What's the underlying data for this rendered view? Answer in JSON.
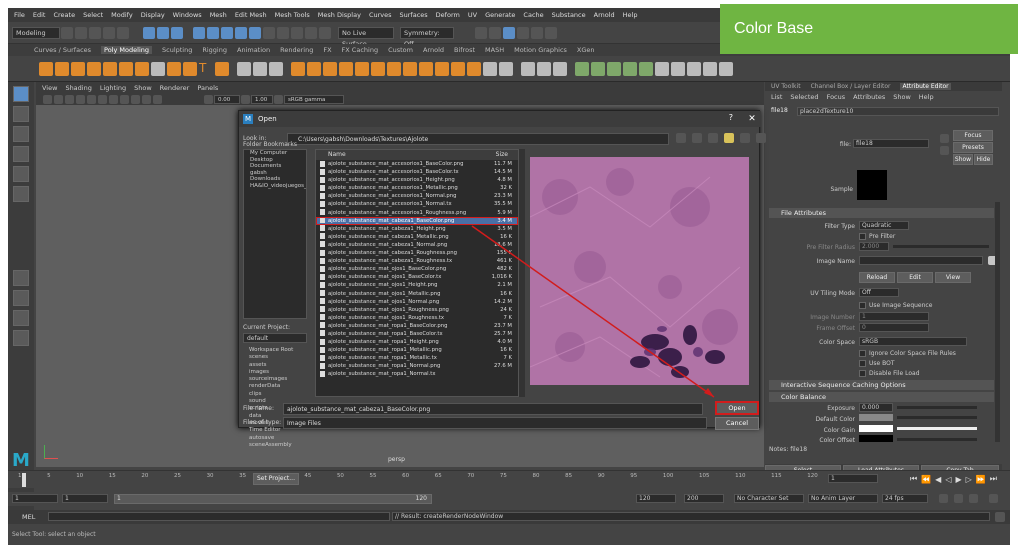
{
  "banner": {
    "label": "Color Base"
  },
  "menubar": [
    "File",
    "Edit",
    "Create",
    "Select",
    "Modify",
    "Display",
    "Windows",
    "Mesh",
    "Edit Mesh",
    "Mesh Tools",
    "Mesh Display",
    "Curves",
    "Surfaces",
    "Deform",
    "UV",
    "Generate",
    "Cache",
    "Substance",
    "Arnold",
    "Help"
  ],
  "statusline": {
    "mode": "Modeling",
    "live_surface": "No Live Surface",
    "symmetry": "Symmetry: Off"
  },
  "shelf_tabs": [
    "Curves / Surfaces",
    "Poly Modeling",
    "Sculpting",
    "Rigging",
    "Animation",
    "Rendering",
    "FX",
    "FX Caching",
    "Custom",
    "Arnold",
    "Bifrost",
    "MASH",
    "Motion Graphics",
    "XGen"
  ],
  "shelf_active": "Poly Modeling",
  "viewport": {
    "menus": [
      "View",
      "Shading",
      "Lighting",
      "Show",
      "Renderer",
      "Panels"
    ],
    "val_a": "0.00",
    "val_b": "1.00",
    "colorspace": "sRGB gamma",
    "camera_label": "persp"
  },
  "attribute_editor": {
    "tabs": [
      "UV Toolkit",
      "Channel Box / Layer Editor",
      "Attribute Editor"
    ],
    "active_tab": "Attribute Editor",
    "menus": [
      "List",
      "Selected",
      "Focus",
      "Attributes",
      "Show",
      "Help"
    ],
    "node_tab_a": "file18",
    "node_tab_b": "place2dTexture10",
    "file_label": "file:",
    "file_value": "file18",
    "focus_btn": "Focus",
    "presets_btn": "Presets",
    "show_btn": "Show",
    "hide_btn": "Hide",
    "sample_label": "Sample",
    "section_file": "File Attributes",
    "filter_type_label": "Filter Type",
    "filter_type_value": "Quadratic",
    "pre_filter_label": "Pre Filter",
    "pre_filter_radius_label": "Pre Filter Radius",
    "pre_filter_radius_value": "2.000",
    "image_name_label": "Image Name",
    "reload_btn": "Reload",
    "edit_btn": "Edit",
    "view_btn": "View",
    "uv_tiling_label": "UV Tiling Mode",
    "uv_tiling_value": "Off",
    "use_seq_label": "Use Image Sequence",
    "image_number_label": "Image Number",
    "image_number_value": "1",
    "frame_offset_label": "Frame Offset",
    "frame_offset_value": "0",
    "color_space_label": "Color Space",
    "color_space_value": "sRGB",
    "ignore_cs_label": "Ignore Color Space File Rules",
    "use_bot_label": "Use BOT",
    "disable_load_label": "Disable File Load",
    "section_seq": "Interactive Sequence Caching Options",
    "section_color": "Color Balance",
    "exposure_label": "Exposure",
    "exposure_value": "0.000",
    "default_color_label": "Default Color",
    "color_gain_label": "Color Gain",
    "color_offset_label": "Color Offset",
    "notes_label": "Notes:",
    "notes_value": "file18",
    "select_btn": "Select",
    "load_attr_btn": "Load Attributes",
    "copy_tab_btn": "Copy Tab"
  },
  "timeline": {
    "ticks": [
      "1",
      "5",
      "10",
      "15",
      "20",
      "25",
      "30",
      "35",
      "40",
      "45",
      "50",
      "55",
      "60",
      "65",
      "70",
      "75",
      "80",
      "85",
      "90",
      "95",
      "100",
      "105",
      "110",
      "115",
      "120"
    ],
    "current": "1",
    "range_start": "1",
    "range_in": "1",
    "range_slider_start": "1",
    "range_slider_end": "120",
    "range_out": "120",
    "range_end": "200",
    "character_set": "No Character Set",
    "anim_layer": "No Anim Layer",
    "fps": "24 fps"
  },
  "command": {
    "lang": "MEL",
    "result": "// Result: createRenderNodeWindow"
  },
  "help_line": "Select Tool: select an object",
  "dialog": {
    "title": "Open",
    "help": "?",
    "look_in_label": "Look in:",
    "look_in_path": "C:\\Users\\gabsh\\Downloads\\Textures\\Ajolote",
    "bookmarks_label": "Folder Bookmarks",
    "bookmarks": [
      "My Computer",
      "Desktop",
      "Documents",
      "gabsh",
      "Downloads",
      "HA&IO_videojuegos_s"
    ],
    "current_project_label": "Current Project:",
    "current_project": "default",
    "project_folders": [
      "Workspace Root",
      "scenes",
      "assets",
      "images",
      "sourceimages",
      "renderData",
      "clips",
      "sound",
      "scripts",
      "data",
      "movies",
      "Time Editor",
      "autosave",
      "sceneAssembly"
    ],
    "set_project_btn": "Set Project...",
    "col_name": "Name",
    "col_size": "Size",
    "files": [
      {
        "name": "ajolote_substance_mat_accesorios1_BaseColor.png",
        "size": "11.7 M"
      },
      {
        "name": "ajolote_substance_mat_accesorios1_BaseColor.tx",
        "size": "14.5 M"
      },
      {
        "name": "ajolote_substance_mat_accesorios1_Height.png",
        "size": "4.8 M"
      },
      {
        "name": "ajolote_substance_mat_accesorios1_Metallic.png",
        "size": "32 K"
      },
      {
        "name": "ajolote_substance_mat_accesorios1_Normal.png",
        "size": "23.3 M"
      },
      {
        "name": "ajolote_substance_mat_accesorios1_Normal.tx",
        "size": "35.5 M"
      },
      {
        "name": "ajolote_substance_mat_accesorios1_Roughness.png",
        "size": "5.9 M"
      },
      {
        "name": "ajolote_substance_mat_cabeza1_BaseColor.png",
        "size": "3.4 M"
      },
      {
        "name": "ajolote_substance_mat_cabeza1_Height.png",
        "size": "3.5 M"
      },
      {
        "name": "ajolote_substance_mat_cabeza1_Metallic.png",
        "size": "16 K"
      },
      {
        "name": "ajolote_substance_mat_cabeza1_Normal.png",
        "size": "13.6 M"
      },
      {
        "name": "ajolote_substance_mat_cabeza1_Roughness.png",
        "size": "155 K"
      },
      {
        "name": "ajolote_substance_mat_cabeza1_Roughness.tx",
        "size": "461 K"
      },
      {
        "name": "ajolote_substance_mat_ojos1_BaseColor.png",
        "size": "482 K"
      },
      {
        "name": "ajolote_substance_mat_ojos1_BaseColor.tx",
        "size": "1,016 K"
      },
      {
        "name": "ajolote_substance_mat_ojos1_Height.png",
        "size": "2.1 M"
      },
      {
        "name": "ajolote_substance_mat_ojos1_Metallic.png",
        "size": "16 K"
      },
      {
        "name": "ajolote_substance_mat_ojos1_Normal.png",
        "size": "14.2 M"
      },
      {
        "name": "ajolote_substance_mat_ojos1_Roughness.png",
        "size": "24 K"
      },
      {
        "name": "ajolote_substance_mat_ojos1_Roughness.tx",
        "size": "7 K"
      },
      {
        "name": "ajolote_substance_mat_ropa1_BaseColor.png",
        "size": "23.7 M"
      },
      {
        "name": "ajolote_substance_mat_ropa1_BaseColor.tx",
        "size": "25.7 M"
      },
      {
        "name": "ajolote_substance_mat_ropa1_Height.png",
        "size": "4.0 M"
      },
      {
        "name": "ajolote_substance_mat_ropa1_Metallic.png",
        "size": "16 K"
      },
      {
        "name": "ajolote_substance_mat_ropa1_Metallic.tx",
        "size": "7 K"
      },
      {
        "name": "ajolote_substance_mat_ropa1_Normal.png",
        "size": "27.6 M"
      },
      {
        "name": "ajolote_substance_mat_ropa1_Normal.tx",
        "size": ""
      }
    ],
    "selected_index": 7,
    "file_name_label": "File name:",
    "file_name_value": "ajolote_substance_mat_cabeza1_BaseColor.png",
    "files_of_type_label": "Files of type:",
    "files_of_type_value": "Image Files",
    "open_btn": "Open",
    "cancel_btn": "Cancel"
  },
  "colors": {
    "accent_red": "#d21c1c",
    "banner_green": "#6fb542",
    "selection_blue": "#4a6fa5",
    "preview_pink": "#a86aa0"
  }
}
